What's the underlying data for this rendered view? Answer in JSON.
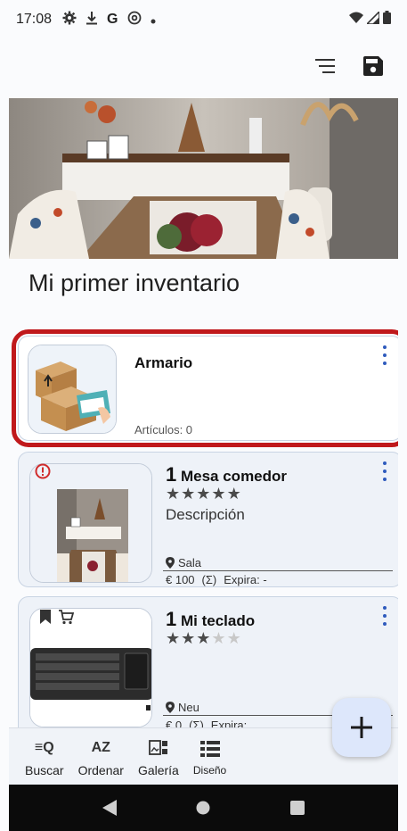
{
  "status_bar": {
    "time": "17:08",
    "icons": [
      "gear-icon",
      "download-icon",
      "google-icon",
      "at-icon",
      "dot-icon"
    ],
    "right_icons": [
      "wifi-icon",
      "signal-icon",
      "battery-icon"
    ]
  },
  "appbar": {
    "icons": [
      "filter-list-icon",
      "save-icon"
    ]
  },
  "inventory": {
    "title": "Mi primer inventario"
  },
  "cards": [
    {
      "name": "Armario",
      "subtitle": "Artículos: 0",
      "type": "container"
    },
    {
      "qty": "1",
      "name": "Mesa comedor",
      "rating": 5,
      "max_rating": 5,
      "description": "Descripción",
      "location": "Sala",
      "price": "€ 100",
      "sum_symbol": "(Σ)",
      "expiry": "Expira: -",
      "badge_icon": "alert-icon"
    },
    {
      "qty": "1",
      "name": "Mi teclado",
      "rating": 3,
      "max_rating": 5,
      "location": "Neu",
      "price": "€ 0",
      "sum_symbol": "(Σ)",
      "expiry": "Expira:",
      "badge_icons": [
        "bookmark-icon",
        "cart-icon"
      ]
    }
  ],
  "fab": {
    "icon": "plus-icon"
  },
  "bottom_bar": {
    "items": [
      {
        "label": "Buscar",
        "icon": "search-list-icon",
        "icon_text": "≡Q"
      },
      {
        "label": "Ordenar",
        "icon": "sort-az-icon",
        "icon_text": "AZ"
      },
      {
        "label": "Galería",
        "icon": "gallery-icon"
      },
      {
        "label": "Diseño",
        "icon": "layout-icon"
      }
    ]
  },
  "nav_bar": {
    "icons": [
      "back-icon",
      "home-icon",
      "recents-icon"
    ]
  },
  "colors": {
    "accent": "#2f5bbd",
    "highlight": "#c0191c",
    "fab_bg": "#dde7fb",
    "card_border": "#c9d4e3"
  }
}
